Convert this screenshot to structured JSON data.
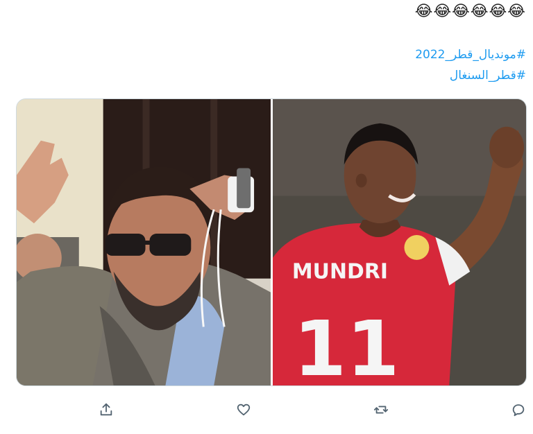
{
  "tweet": {
    "emoji_line": "😂😂😂😂😂😂",
    "hashtags": [
      "#مونديال_قطر_2022",
      "#قطر_السنغال"
    ]
  },
  "media": {
    "left_photo": {
      "subject": "man-with-sunglasses-waving",
      "accent_color": "#6f6a61"
    },
    "right_photo": {
      "subject": "football-player-celebrating",
      "jersey_name": "MUNDRI",
      "jersey_number": "11",
      "accent_color": "#d6283a"
    }
  },
  "actions": [
    {
      "name": "share-icon"
    },
    {
      "name": "heart-icon"
    },
    {
      "name": "retweet-icon"
    },
    {
      "name": "reply-icon"
    }
  ],
  "colors": {
    "hashtag": "#1d9bf0",
    "icon": "#536471",
    "border": "#cfd9de"
  }
}
